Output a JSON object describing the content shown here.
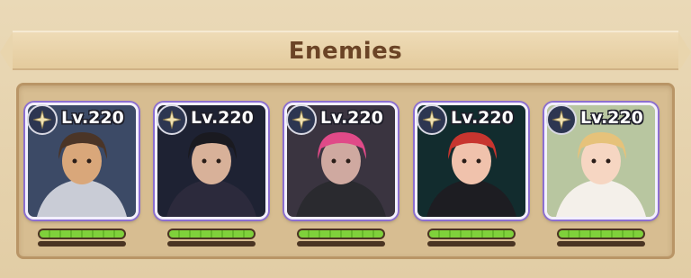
{
  "header": {
    "title": "Enemies"
  },
  "enemies": [
    {
      "level": "Lv.220",
      "bg": "#3c4a66",
      "skin": "#d9a77a",
      "hair": "#4b3527",
      "outfit": "#c9ccd6",
      "hp": 1.0
    },
    {
      "level": "Lv.220",
      "bg": "#1e2233",
      "skin": "#d8b199",
      "hair": "#1a1a20",
      "outfit": "#2c2a3c",
      "hp": 1.0
    },
    {
      "level": "Lv.220",
      "bg": "#3a3440",
      "skin": "#cfa9a0",
      "hair": "#e04a88",
      "outfit": "#2a2a2f",
      "hp": 1.0
    },
    {
      "level": "Lv.220",
      "bg": "#122c2e",
      "skin": "#f0c2ac",
      "hair": "#c8352f",
      "outfit": "#1d1d22",
      "hp": 1.0
    },
    {
      "level": "Lv.220",
      "bg": "#b8c6a0",
      "skin": "#f6d6c2",
      "hair": "#e6c27a",
      "outfit": "#f4f0ea",
      "hp": 1.0
    }
  ],
  "icons": {
    "star": "star-icon"
  }
}
